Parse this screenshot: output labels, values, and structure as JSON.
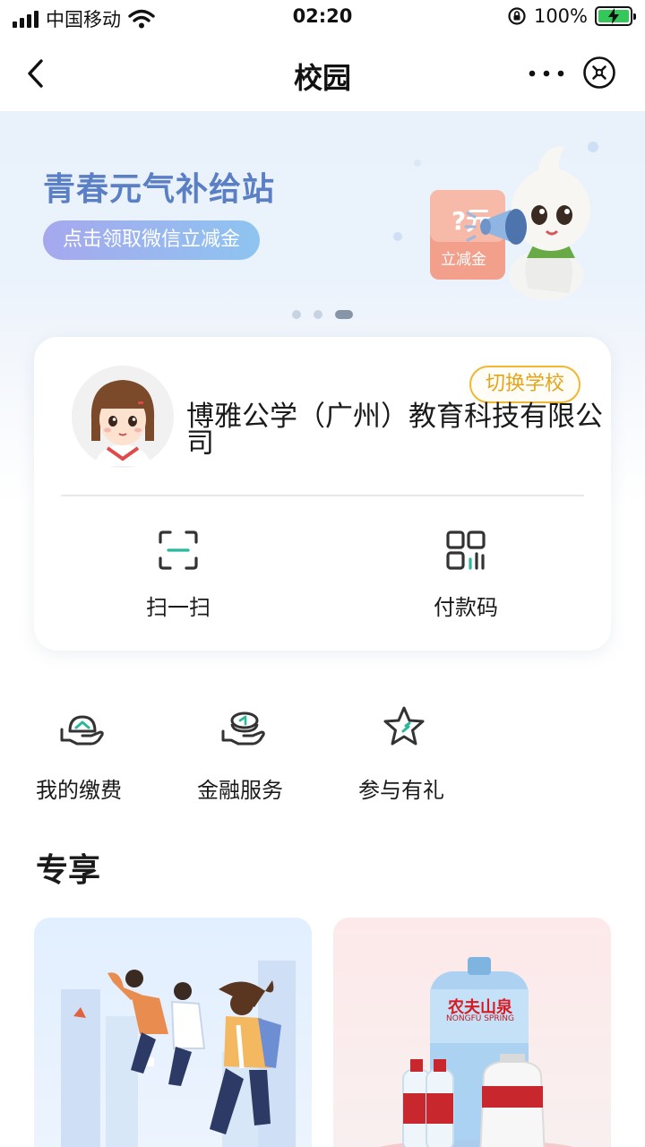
{
  "status_bar": {
    "carrier": "中国移动",
    "time": "02:20",
    "battery": "100%",
    "battery_level": 1.0
  },
  "nav": {
    "title": "校园"
  },
  "banner": {
    "title": "青春元气补给站",
    "button": "点击领取微信立减金",
    "coupon_amount": "?元",
    "coupon_label": "立减金",
    "slide_count": 3,
    "active_slide": 3
  },
  "school_card": {
    "switch_label": "切换学校",
    "school_name": "博雅公学（广州）教育科技有限公司",
    "actions": [
      {
        "label": "扫一扫",
        "icon": "scan-icon"
      },
      {
        "label": "付款码",
        "icon": "payment-code-icon"
      }
    ]
  },
  "functions": [
    {
      "label": "我的缴费",
      "icon": "hand-payment-icon"
    },
    {
      "label": "金融服务",
      "icon": "hand-finance-icon"
    },
    {
      "label": "参与有礼",
      "icon": "star-icon"
    }
  ],
  "section": {
    "title": "专享"
  },
  "promos": [
    {
      "name": "students-illustration"
    },
    {
      "name": "nongfu-spring",
      "brand": "农夫山泉",
      "brand_sub": "NONGFU SPRING"
    }
  ],
  "colors": {
    "accent_green": "#2bb89a",
    "switch_orange": "#e3a51c",
    "banner_blue": "#5b7fc4",
    "brand_red": "#d61c22"
  }
}
